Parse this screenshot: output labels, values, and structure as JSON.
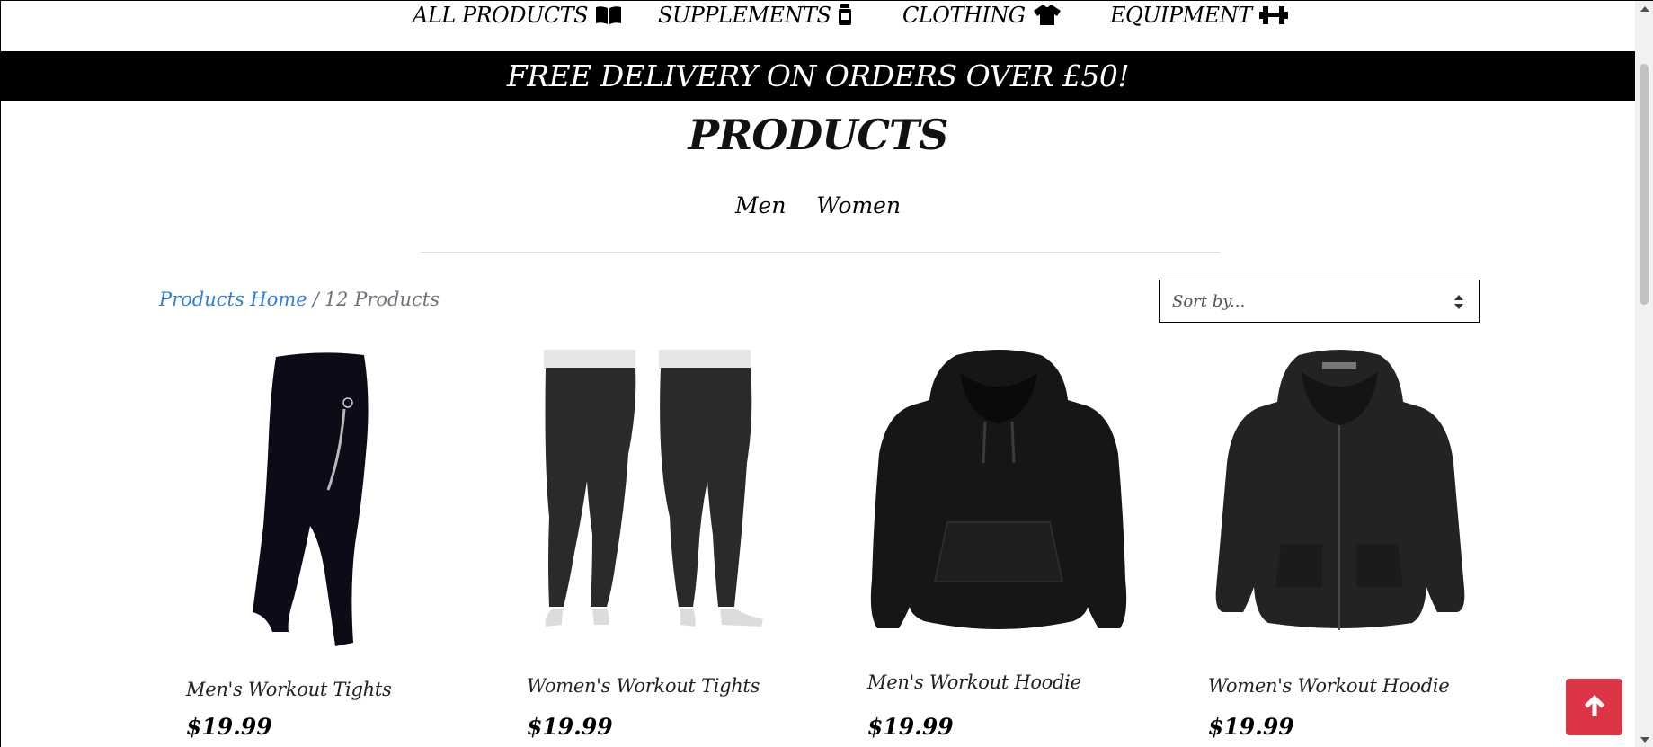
{
  "nav": {
    "items": [
      {
        "label": "ALL PRODUCTS",
        "icon": "book-icon"
      },
      {
        "label": "SUPPLEMENTS",
        "icon": "supplement-jar-icon"
      },
      {
        "label": "CLOTHING",
        "icon": "tshirt-icon"
      },
      {
        "label": "EQUIPMENT",
        "icon": "dumbbell-icon"
      }
    ]
  },
  "banner": {
    "text": "FREE DELIVERY ON ORDERS OVER £50!"
  },
  "page_title": "PRODUCTS",
  "gender_links": [
    "Men",
    "Women"
  ],
  "breadcrumb": {
    "home": "Products Home",
    "separator": "/",
    "count": "12 Products"
  },
  "sort": {
    "placeholder": "Sort by..."
  },
  "products": [
    {
      "name": "Men's Workout Tights",
      "price": "$19.99",
      "image": "mens-tights"
    },
    {
      "name": "Women's Workout Tights",
      "price": "$19.99",
      "image": "womens-tights"
    },
    {
      "name": "Men's Workout Hoodie",
      "price": "$19.99",
      "image": "mens-hoodie"
    },
    {
      "name": "Women's Workout Hoodie",
      "price": "$19.99",
      "image": "womens-hoodie"
    }
  ],
  "colors": {
    "banner_bg": "#000000",
    "link": "#2f7fd6",
    "to_top_button": "#dc3545"
  },
  "to_top_icon": "arrow-up-icon"
}
